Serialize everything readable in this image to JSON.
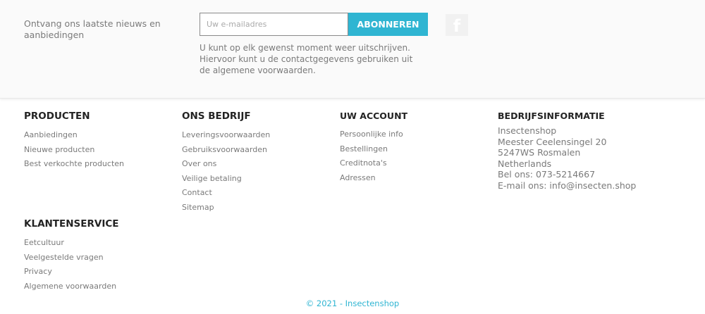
{
  "newsletter": {
    "label": "Ontvang ons laatste nieuws en aanbiedingen",
    "email_placeholder": "Uw e-mailadres",
    "email_value": "",
    "subscribe_label": "ABONNEREN",
    "note": "U kunt op elk gewenst moment weer uitschrijven. Hiervoor kunt u de contactgegevens gebruiken uit de algemene voorwaarden.",
    "social_icon": "f"
  },
  "columns": {
    "producten": {
      "title": "PRODUCTEN",
      "links": [
        "Aanbiedingen",
        "Nieuwe producten",
        "Best verkochte producten"
      ]
    },
    "bedrijf": {
      "title": "ONS BEDRIJF",
      "links": [
        "Leveringsvoorwaarden",
        "Gebruiksvoorwaarden",
        "Over ons",
        "Veilige betaling",
        "Contact",
        "Sitemap"
      ]
    },
    "account": {
      "title": "UW ACCOUNT",
      "links": [
        "Persoonlijke info",
        "Bestellingen",
        "Creditnota's",
        "Adressen"
      ]
    },
    "info": {
      "title": "BEDRIJFSINFORMATIE",
      "lines": [
        "Insectenshop",
        "Meester Ceelensingel 20",
        "5247WS Rosmalen",
        "Netherlands",
        "Bel ons: 073-5214667",
        "E-mail ons: info@insecten.shop"
      ]
    },
    "klantenservice": {
      "title": "KLANTENSERVICE",
      "links": [
        "Eetcultuur",
        "Veelgestelde vragen",
        "Privacy",
        "Algemene voorwaarden"
      ]
    }
  },
  "copyright": "© 2021 - Insectenshop",
  "colors": {
    "accent": "#2fb5d2",
    "heading": "#232323",
    "text": "#7a7a7a"
  }
}
